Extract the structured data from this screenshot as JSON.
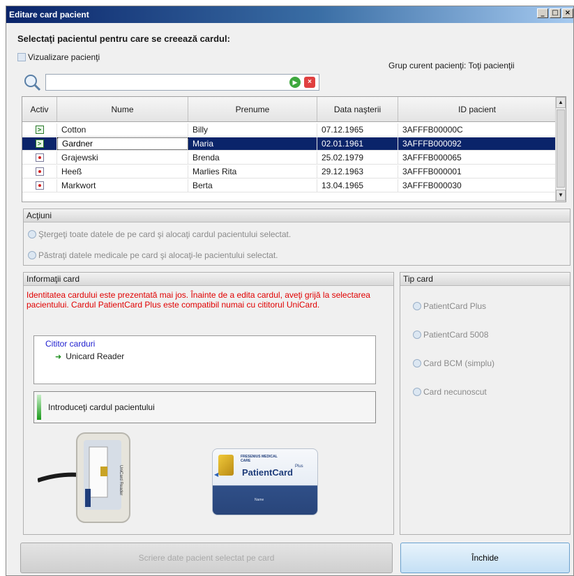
{
  "window": {
    "title": "Editare card pacient"
  },
  "heading": "Selectaţi pacientul pentru care se creează cardul:",
  "view_toggle": {
    "label": "Vizualizare pacienţi"
  },
  "group_label": "Grup curent pacienţi: Toţi pacienţii",
  "search": {
    "value": "",
    "placeholder": ""
  },
  "table": {
    "columns": [
      "Activ",
      "Nume",
      "Prenume",
      "Data naşterii",
      "ID pacient"
    ],
    "rows": [
      {
        "status": "active",
        "nume": "Cotton",
        "prenume": "Billy",
        "data": "07.12.1965",
        "id": "3AFFFB00000C"
      },
      {
        "status": "active",
        "nume": "Gardner",
        "prenume": "Maria",
        "data": "02.01.1961",
        "id": "3AFFFB000092"
      },
      {
        "status": "inactive",
        "nume": "Grajewski",
        "prenume": "Brenda",
        "data": "25.02.1979",
        "id": "3AFFFB000065"
      },
      {
        "status": "inactive",
        "nume": "Heeß",
        "prenume": "Marlies Rita",
        "data": "29.12.1963",
        "id": "3AFFFB000001"
      },
      {
        "status": "inactive",
        "nume": "Markwort",
        "prenume": "Berta",
        "data": "13.04.1965",
        "id": "3AFFFB000030"
      }
    ],
    "selected_row": 1
  },
  "actions": {
    "title": "Acţiuni",
    "option1": "Ştergeţi toate datele de pe card şi alocaţi cardul pacientului selectat.",
    "option2": "Păstraţi datele medicale pe card şi alocaţi-le pacientului selectat."
  },
  "card_info": {
    "title": "Informaţii card",
    "message": "Identitatea cardului este prezentată mai jos. Înainte de a edita cardul, aveţi grijă la selectarea pacientului. Cardul PatientCard Plus este compatibil numai cu cititorul UniCard.",
    "tree_root": "Cititor carduri",
    "tree_child": "Unicard Reader",
    "status": "Introduceţi cardul pacientului",
    "reader_label": "UniCard Reader",
    "card_brand": "PatientCard",
    "card_brand_suffix": "Plus",
    "card_company": "FRESENIUS MEDICAL CARE",
    "card_name": "Name"
  },
  "card_type": {
    "title": "Tip card",
    "options": [
      "PatientCard Plus",
      "PatientCard 5008",
      "Card BCM (simplu)",
      "Card necunoscut"
    ]
  },
  "buttons": {
    "write": "Scriere date pacient selectat pe card",
    "close": "Închide"
  },
  "colors": {
    "title_bar": "#0a246a",
    "selection": "#0a246a",
    "warning_text": "#e00000",
    "accent_green": "#1b9a1b"
  }
}
